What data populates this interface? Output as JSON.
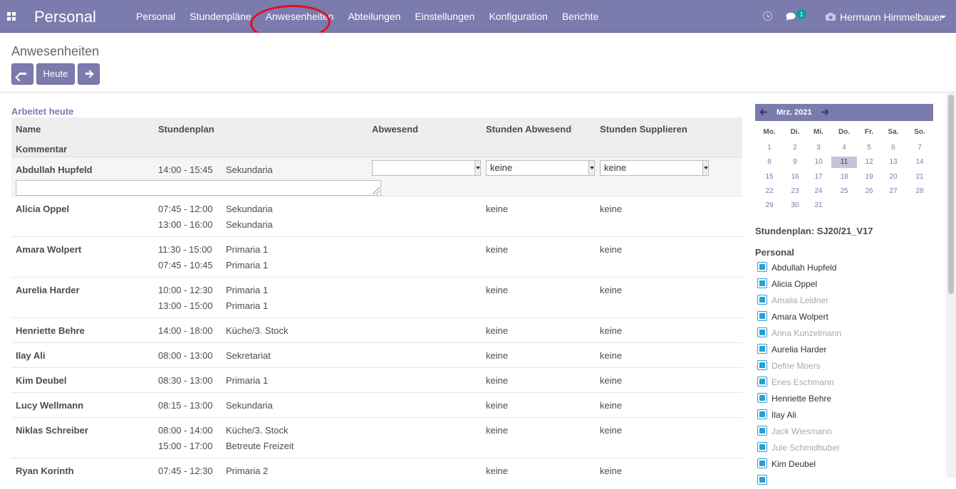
{
  "topbar": {
    "brand": "Personal",
    "menu": [
      "Personal",
      "Stundenpläne",
      "Anwesenheiten",
      "Abteilungen",
      "Einstellungen",
      "Konfiguration",
      "Berichte"
    ],
    "chat_count": "1",
    "user_name": "Hermann Himmelbauer",
    "bg_color": "#7c7bad",
    "highlight_color": "#e0101a"
  },
  "control": {
    "title": "Anwesenheiten",
    "today_label": "Heute"
  },
  "main": {
    "section_title": "Arbeitet heute",
    "headers": {
      "name": "Name",
      "schedule": "Stundenplan",
      "absent": "Abwesend",
      "hours_absent": "Stunden Abwesend",
      "hours_substitute": "Stunden Supplieren",
      "comment": "Kommentar"
    },
    "first_row": {
      "name": "Abdullah Hupfeld",
      "time": "14:00 - 15:45",
      "place": "Sekundaria",
      "absent_value": "",
      "hours_absent_value": "keine",
      "hours_substitute_value": "keine",
      "comment_value": ""
    },
    "rows": [
      {
        "name": "Alicia Oppel",
        "slots": [
          {
            "time": "07:45 - 12:00",
            "place": "Sekundaria"
          },
          {
            "time": "13:00 - 16:00",
            "place": "Sekundaria"
          }
        ],
        "hours_absent": "keine",
        "hours_substitute": "keine"
      },
      {
        "name": "Amara Wolpert",
        "slots": [
          {
            "time": "11:30 - 15:00",
            "place": "Primaria 1"
          },
          {
            "time": "07:45 - 10:45",
            "place": "Primaria 1"
          }
        ],
        "hours_absent": "keine",
        "hours_substitute": "keine"
      },
      {
        "name": "Aurelia Harder",
        "slots": [
          {
            "time": "10:00 - 12:30",
            "place": "Primaria 1"
          },
          {
            "time": "13:00 - 15:00",
            "place": "Primaria 1"
          }
        ],
        "hours_absent": "keine",
        "hours_substitute": "keine"
      },
      {
        "name": "Henriette Behre",
        "slots": [
          {
            "time": "14:00 - 18:00",
            "place": "Küche/3. Stock"
          }
        ],
        "hours_absent": "keine",
        "hours_substitute": "keine"
      },
      {
        "name": "Ilay Ali",
        "slots": [
          {
            "time": "08:00 - 13:00",
            "place": "Sekretariat"
          }
        ],
        "hours_absent": "keine",
        "hours_substitute": "keine"
      },
      {
        "name": "Kim Deubel",
        "slots": [
          {
            "time": "08:30 - 13:00",
            "place": "Primaria 1"
          }
        ],
        "hours_absent": "keine",
        "hours_substitute": "keine"
      },
      {
        "name": "Lucy Wellmann",
        "slots": [
          {
            "time": "08:15 - 13:00",
            "place": "Sekundaria"
          }
        ],
        "hours_absent": "keine",
        "hours_substitute": "keine"
      },
      {
        "name": "Niklas Schreiber",
        "slots": [
          {
            "time": "08:00 - 14:00",
            "place": "Küche/3. Stock"
          },
          {
            "time": "15:00 - 17:00",
            "place": "Betreute Freizeit"
          }
        ],
        "hours_absent": "keine",
        "hours_substitute": "keine"
      },
      {
        "name": "Ryan Korinth",
        "slots": [
          {
            "time": "07:45 - 12:30",
            "place": "Primaria 2"
          }
        ],
        "hours_absent": "keine",
        "hours_substitute": "keine"
      }
    ]
  },
  "calendar": {
    "month_label": "Mrz. 2021",
    "weekdays": [
      "Mo.",
      "Di.",
      "Mi.",
      "Do.",
      "Fr.",
      "Sa.",
      "So."
    ],
    "weeks": [
      [
        "1",
        "2",
        "3",
        "4",
        "5",
        "6",
        "7"
      ],
      [
        "8",
        "9",
        "10",
        "11",
        "12",
        "13",
        "14"
      ],
      [
        "15",
        "16",
        "17",
        "18",
        "19",
        "20",
        "21"
      ],
      [
        "22",
        "23",
        "24",
        "25",
        "26",
        "27",
        "28"
      ],
      [
        "29",
        "30",
        "31",
        "",
        "",
        "",
        ""
      ]
    ],
    "selected_day": "11"
  },
  "sidebar": {
    "schedule_label": "Stundenplan: SJ20/21_V17",
    "staff_label": "Personal",
    "staff": [
      {
        "name": "Abdullah Hupfeld",
        "active": true
      },
      {
        "name": "Alicia Oppel",
        "active": true
      },
      {
        "name": "Amalia Leidner",
        "active": false
      },
      {
        "name": "Amara Wolpert",
        "active": true
      },
      {
        "name": "Anna Kunzelmann",
        "active": false
      },
      {
        "name": "Aurelia Harder",
        "active": true
      },
      {
        "name": "Defne Moers",
        "active": false
      },
      {
        "name": "Enes Eschmann",
        "active": false
      },
      {
        "name": "Henriette Behre",
        "active": true
      },
      {
        "name": "Ilay Ali",
        "active": true
      },
      {
        "name": "Jack Wiesmann",
        "active": false
      },
      {
        "name": "Jule Schmidhuber",
        "active": false
      },
      {
        "name": "Kim Deubel",
        "active": true
      },
      {
        "name": "",
        "active": true
      }
    ]
  }
}
